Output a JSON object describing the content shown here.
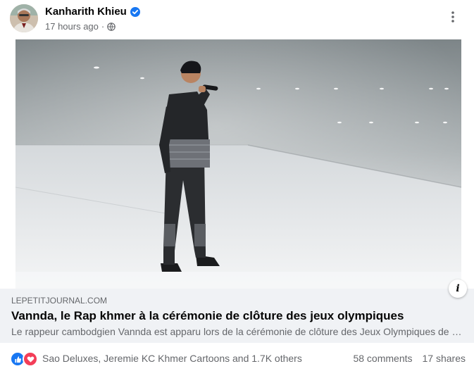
{
  "post": {
    "author": "Kanharith Khieu",
    "time": "17 hours ago",
    "separator": "·"
  },
  "link": {
    "domain": "LEPETITJOURNAL.COM",
    "title": "Vannda, le Rap khmer à la cérémonie de clôture des jeux olympiques",
    "description": "Le rappeur cambodgien Vannda est apparu lors de la cérémonie de clôture des Jeux Olympiques de Paris",
    "info_glyph": "i"
  },
  "reactions": {
    "names": "Sao Deluxes, Jeremie KC Khmer Cartoons and 1.7K others",
    "comments": "58 comments",
    "shares": "17 shares",
    "types": [
      "like-icon",
      "love-icon"
    ]
  },
  "colors": {
    "brand_blue": "#1877f2",
    "love_red": "#f33e58",
    "secondary_text": "#65676b",
    "link_bg": "#f0f2f5"
  }
}
